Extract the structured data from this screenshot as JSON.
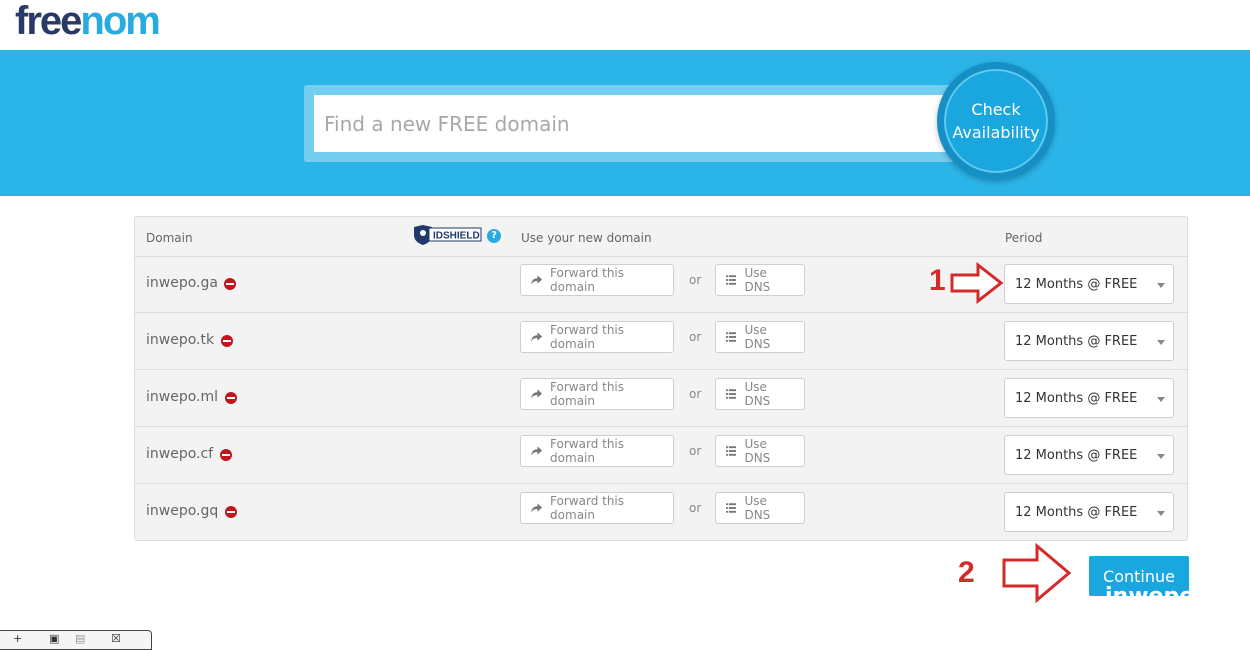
{
  "logo": {
    "part1": "free",
    "part2": "nom"
  },
  "search": {
    "placeholder": "Find a new FREE domain",
    "button_label": "Check Availability"
  },
  "table": {
    "headers": {
      "domain": "Domain",
      "use": "Use your new domain",
      "period": "Period",
      "idshield": "IDSHIELD",
      "help": "?"
    },
    "rows": [
      {
        "domain": "inwepo.ga",
        "forward_label": "Forward this domain",
        "or": "or",
        "dns_label": "Use DNS",
        "period": "12 Months @ FREE"
      },
      {
        "domain": "inwepo.tk",
        "forward_label": "Forward this domain",
        "or": "or",
        "dns_label": "Use DNS",
        "period": "12 Months @ FREE"
      },
      {
        "domain": "inwepo.ml",
        "forward_label": "Forward this domain",
        "or": "or",
        "dns_label": "Use DNS",
        "period": "12 Months @ FREE"
      },
      {
        "domain": "inwepo.cf",
        "forward_label": "Forward this domain",
        "or": "or",
        "dns_label": "Use DNS",
        "period": "12 Months @ FREE"
      },
      {
        "domain": "inwepo.gq",
        "forward_label": "Forward this domain",
        "or": "or",
        "dns_label": "Use DNS",
        "period": "12 Months @ FREE"
      }
    ]
  },
  "annotations": {
    "step1": "1",
    "step2": "2"
  },
  "continue": {
    "label": "Continue",
    "overlay_text": "inwepo"
  },
  "colors": {
    "hero": "#2ab4e8",
    "brand_dark": "#2a3a66",
    "brand_light": "#29abe2",
    "annotation": "#d62a2a",
    "remove": "#c0171c"
  },
  "icons": {
    "forward": "share-arrow-icon",
    "dns": "list-icon",
    "remove": "remove-circle-icon",
    "help": "help-circle-icon",
    "shield": "shield-icon"
  }
}
